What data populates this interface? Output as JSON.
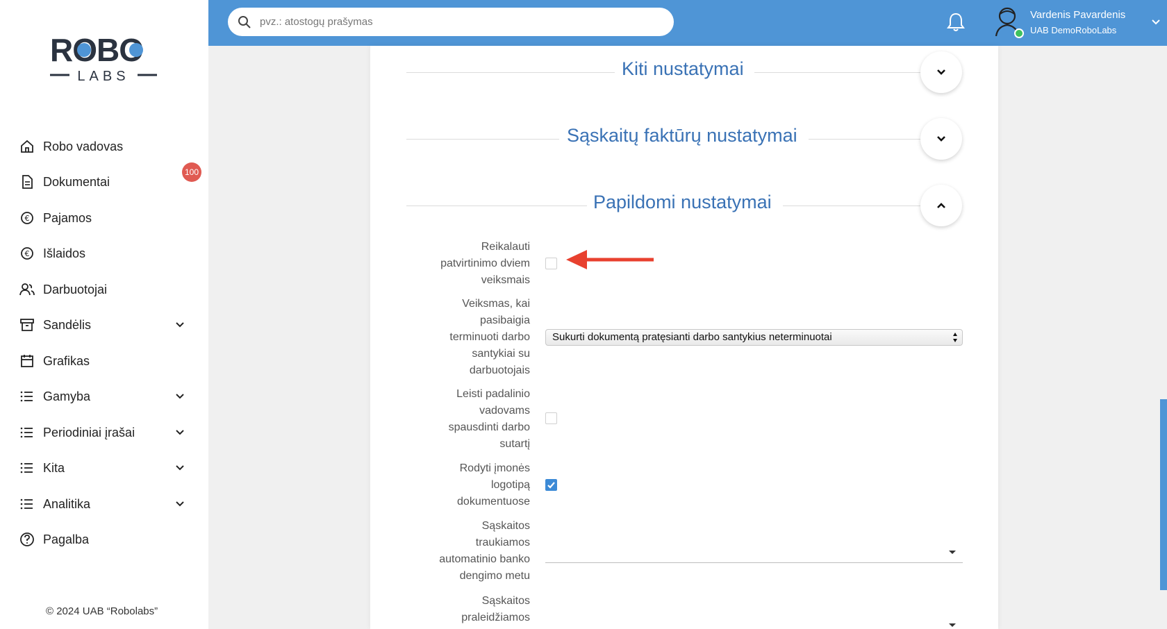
{
  "brand": {
    "logo_top": "ROBO",
    "logo_bottom": "LABS",
    "copyright": "© 2024 UAB “Robolabs”"
  },
  "sidebar": {
    "items": [
      {
        "label": "Robo vadovas",
        "icon": "home-icon",
        "expandable": false
      },
      {
        "label": "Dokumentai",
        "icon": "document-icon",
        "expandable": false,
        "badge": "100"
      },
      {
        "label": "Pajamos",
        "icon": "euro-in-icon",
        "expandable": false
      },
      {
        "label": "Išlaidos",
        "icon": "euro-out-icon",
        "expandable": false
      },
      {
        "label": "Darbuotojai",
        "icon": "users-icon",
        "expandable": false
      },
      {
        "label": "Sandėlis",
        "icon": "archive-icon",
        "expandable": true
      },
      {
        "label": "Grafikas",
        "icon": "calendar-icon",
        "expandable": false
      },
      {
        "label": "Gamyba",
        "icon": "list-icon",
        "expandable": true
      },
      {
        "label": "Periodiniai įrašai",
        "icon": "list-icon",
        "expandable": true
      },
      {
        "label": "Kita",
        "icon": "list-icon",
        "expandable": true
      },
      {
        "label": "Analitika",
        "icon": "list-icon",
        "expandable": true
      },
      {
        "label": "Pagalba",
        "icon": "help-icon",
        "expandable": false
      }
    ]
  },
  "header": {
    "search_placeholder": "pvz.: atostogų prašymas",
    "user_name": "Vardenis Pavardenis",
    "user_company": "UAB DemoRoboLabs"
  },
  "sections": [
    {
      "title": "Kiti nustatymai",
      "expanded": false
    },
    {
      "title": "Sąskaitų faktūrų nustatymai",
      "expanded": false
    },
    {
      "title": "Papildomi nustatymai",
      "expanded": true
    }
  ],
  "settings": {
    "two_step": {
      "label_lines": [
        "Reikalauti",
        "patvirtinimo dviem",
        "veiksmais"
      ],
      "checked": false
    },
    "contract_end": {
      "label_lines": [
        "Veiksmas, kai",
        "pasibaigia",
        "terminuoti darbo",
        "santykiai su",
        "darbuotojais"
      ],
      "value": "Sukurti dokumentą pratęsianti darbo santykius neterminuotai"
    },
    "dept_print": {
      "label_lines": [
        "Leisti padalinio",
        "vadovams",
        "spausdinti darbo",
        "sutartį"
      ],
      "checked": false
    },
    "show_logo": {
      "label_lines": [
        "Rodyti įmonės",
        "logotipą",
        "dokumentuose"
      ],
      "checked": true
    },
    "auto_bank": {
      "label_lines": [
        "Sąskaitos",
        "traukiamos",
        "automatinio banko",
        "dengimo metu"
      ],
      "value": ""
    },
    "skipped": {
      "label_lines": [
        "Sąskaitos",
        "praleidžiamos"
      ],
      "value": ""
    }
  },
  "colors": {
    "accent": "#4f95d6",
    "title": "#3a72b5",
    "badge": "#e05a52",
    "annotation_arrow": "#e8412f"
  }
}
